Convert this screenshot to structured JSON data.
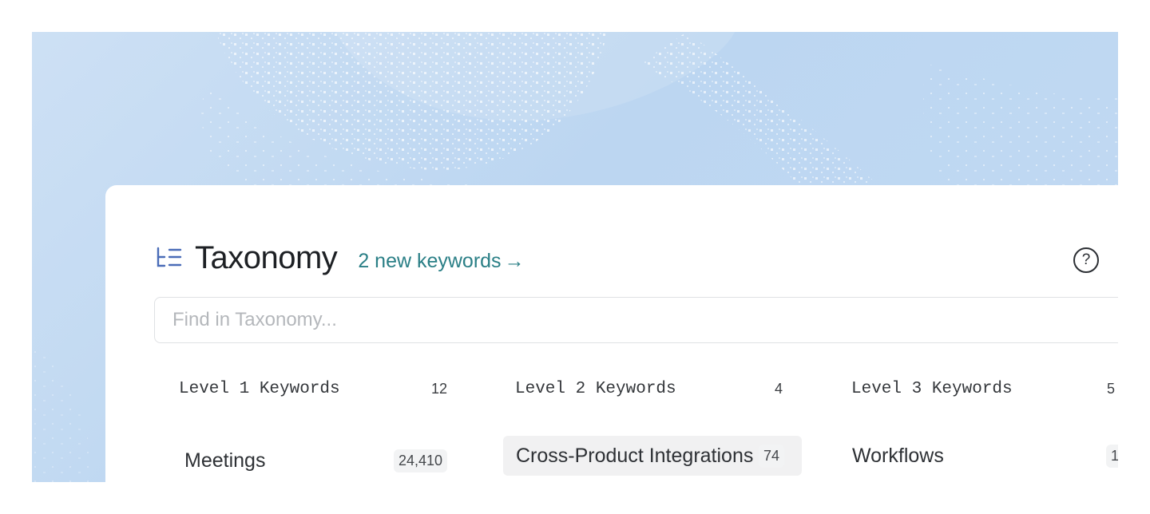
{
  "header": {
    "title": "Taxonomy",
    "new_keywords_link": "2 new keywords",
    "arrow": "→",
    "help_glyph": "?"
  },
  "search": {
    "placeholder": "Find in Taxonomy..."
  },
  "columns": [
    {
      "label": "Level 1 Keywords",
      "count": "12"
    },
    {
      "label": "Level 2 Keywords",
      "count": "4"
    },
    {
      "label": "Level 3 Keywords",
      "count": "5"
    }
  ],
  "rows": {
    "level1": [
      {
        "name": "Meetings",
        "count": "24,410"
      }
    ],
    "level2": [
      {
        "name": "Cross-Product Integrations",
        "count": "74",
        "selected": true
      }
    ],
    "level3": [
      {
        "name": "Workflows",
        "count": "1"
      }
    ]
  },
  "icons": {
    "taxonomy": "taxonomy-tree-icon",
    "help": "help-circle-icon"
  },
  "colors": {
    "accent_link": "#2a7f86",
    "icon_blue": "#4a6cb8",
    "background": "#c5dbf2"
  }
}
